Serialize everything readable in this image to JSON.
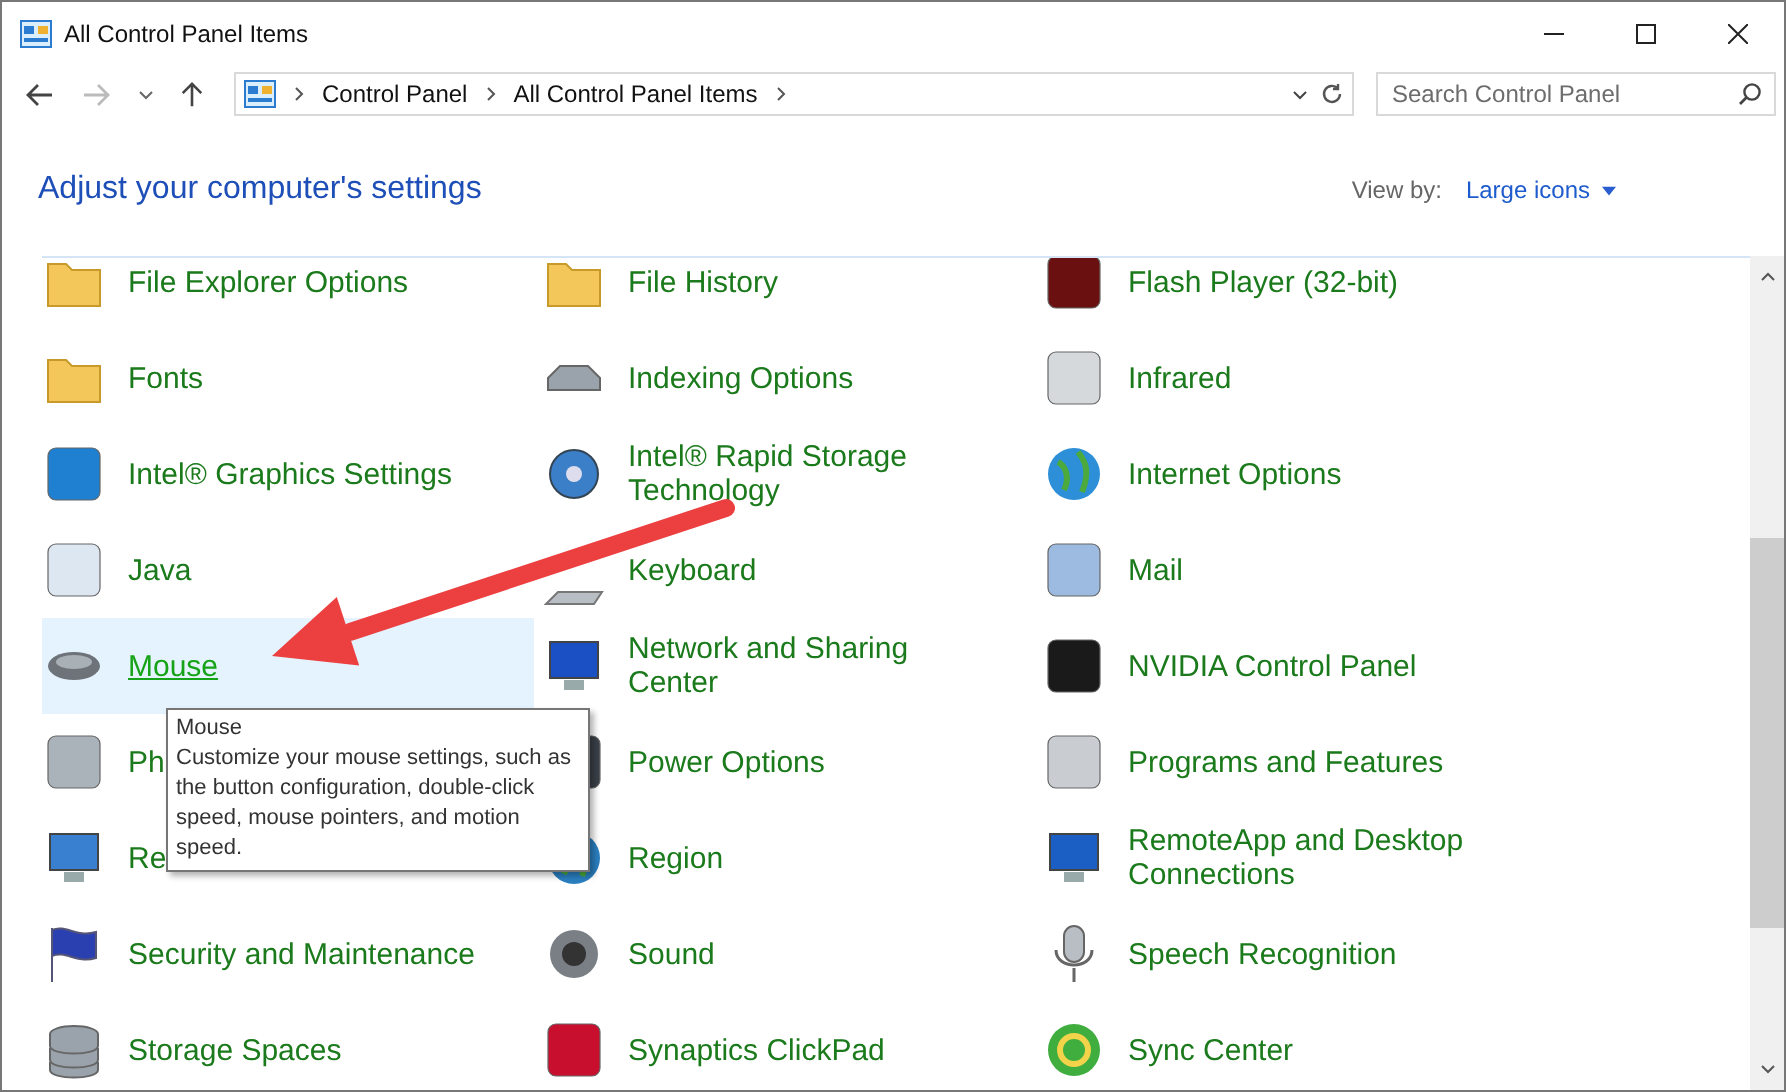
{
  "window": {
    "title": "All Control Panel Items"
  },
  "address_bar": {
    "breadcrumbs": [
      "Control Panel",
      "All Control Panel Items"
    ]
  },
  "search": {
    "placeholder": "Search Control Panel"
  },
  "heading": "Adjust your computer's settings",
  "view_by": {
    "label": "View by:",
    "value": "Large icons"
  },
  "items": [
    {
      "label": "File Explorer Options",
      "selected": false
    },
    {
      "label": "File History",
      "selected": false
    },
    {
      "label": "Flash Player (32-bit)",
      "selected": false
    },
    {
      "label": "Fonts",
      "selected": false
    },
    {
      "label": "Indexing Options",
      "selected": false
    },
    {
      "label": "Infrared",
      "selected": false
    },
    {
      "label": "Intel® Graphics Settings",
      "selected": false
    },
    {
      "label": "Intel® Rapid Storage Technology",
      "selected": false
    },
    {
      "label": "Internet Options",
      "selected": false
    },
    {
      "label": "Java",
      "selected": false
    },
    {
      "label": "Keyboard",
      "selected": false
    },
    {
      "label": "Mail",
      "selected": false
    },
    {
      "label": "Mouse",
      "selected": true
    },
    {
      "label": "Network and Sharing Center",
      "selected": false
    },
    {
      "label": "NVIDIA Control Panel",
      "selected": false
    },
    {
      "label": "Ph",
      "selected": false
    },
    {
      "label": "Power Options",
      "selected": false
    },
    {
      "label": "Programs and Features",
      "selected": false
    },
    {
      "label": "Re",
      "selected": false
    },
    {
      "label": "Region",
      "selected": false
    },
    {
      "label": "RemoteApp and Desktop Connections",
      "selected": false
    },
    {
      "label": "Security and Maintenance",
      "selected": false
    },
    {
      "label": "Sound",
      "selected": false
    },
    {
      "label": "Speech Recognition",
      "selected": false
    },
    {
      "label": "Storage Spaces",
      "selected": false
    },
    {
      "label": "Synaptics ClickPad",
      "selected": false
    },
    {
      "label": "Sync Center",
      "selected": false
    }
  ],
  "tooltip": {
    "title": "Mouse",
    "text": "Customize your mouse settings, such as the button configuration, double-click speed, mouse pointers, and motion speed."
  }
}
